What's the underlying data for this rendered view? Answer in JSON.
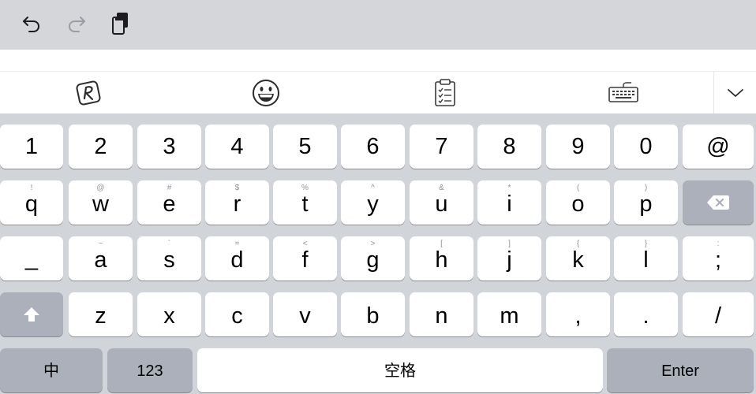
{
  "topbar": {
    "icons": [
      "undo-icon",
      "redo-icon",
      "clipboard-copy-icon"
    ]
  },
  "toolbar": {
    "icons": [
      "handwriting-icon",
      "emoji-icon",
      "clipboard-list-icon",
      "keyboard-icon",
      "collapse-chevron-icon"
    ]
  },
  "keyboard": {
    "rows": [
      {
        "keys": [
          {
            "label": "1"
          },
          {
            "label": "2"
          },
          {
            "label": "3"
          },
          {
            "label": "4"
          },
          {
            "label": "5"
          },
          {
            "label": "6"
          },
          {
            "label": "7"
          },
          {
            "label": "8"
          },
          {
            "label": "9"
          },
          {
            "label": "0"
          },
          {
            "label": "@"
          }
        ]
      },
      {
        "keys": [
          {
            "label": "q",
            "hint": "!"
          },
          {
            "label": "w",
            "hint": "@"
          },
          {
            "label": "e",
            "hint": "#"
          },
          {
            "label": "r",
            "hint": "$"
          },
          {
            "label": "t",
            "hint": "%"
          },
          {
            "label": "y",
            "hint": "^"
          },
          {
            "label": "u",
            "hint": "&"
          },
          {
            "label": "i",
            "hint": "*"
          },
          {
            "label": "o",
            "hint": "("
          },
          {
            "label": "p",
            "hint": ")"
          },
          {
            "icon": "backspace-icon"
          }
        ]
      },
      {
        "keys": [
          {
            "label": "_"
          },
          {
            "label": "a",
            "hint": "~"
          },
          {
            "label": "s",
            "hint": "`"
          },
          {
            "label": "d",
            "hint": "="
          },
          {
            "label": "f",
            "hint": "<"
          },
          {
            "label": "g",
            "hint": ">"
          },
          {
            "label": "h",
            "hint": "["
          },
          {
            "label": "j",
            "hint": "]"
          },
          {
            "label": "k",
            "hint": "{"
          },
          {
            "label": "l",
            "hint": "}"
          },
          {
            "label": ";",
            "hint": ":"
          }
        ]
      },
      {
        "keys": [
          {
            "icon": "shift-icon"
          },
          {
            "label": "z"
          },
          {
            "label": "x"
          },
          {
            "label": "c"
          },
          {
            "label": "v"
          },
          {
            "label": "b"
          },
          {
            "label": "n"
          },
          {
            "label": "m"
          },
          {
            "label": ","
          },
          {
            "label": "."
          },
          {
            "label": "/"
          }
        ]
      }
    ],
    "bottom": {
      "lang": "中",
      "numbers": "123",
      "space": "空格",
      "enter": "Enter"
    }
  }
}
